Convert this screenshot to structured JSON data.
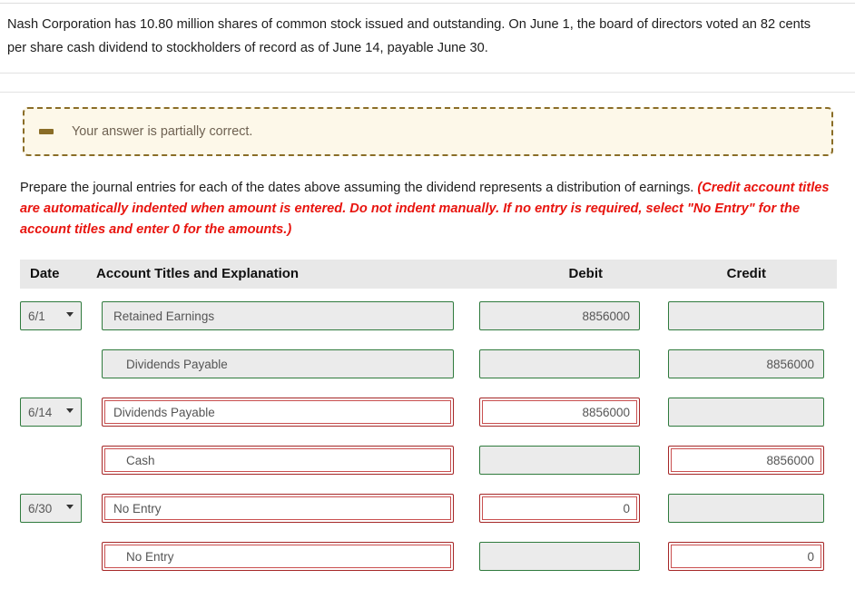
{
  "problem": {
    "statement": "Nash Corporation has 10.80 million shares of common stock issued and outstanding. On June 1, the board of directors voted an 82 cents per share cash dividend to stockholders of record as of June 14, payable June 30."
  },
  "alert": {
    "icon": "minus-icon",
    "message": "Your answer is partially correct.",
    "border_color": "#8a6d27",
    "background_color": "#fdf8e9"
  },
  "instructions": {
    "lead": "Prepare the journal entries for each of the dates above assuming the dividend represents a distribution of earnings. ",
    "emphasis": "(Credit account titles are automatically indented when amount is entered. Do not indent manually. If no entry is required, select \"No Entry\" for the account titles and enter 0 for the amounts.)",
    "emphasis_color": "#e8150f"
  },
  "journal_table": {
    "headers": {
      "date": "Date",
      "account": "Account Titles and Explanation",
      "debit": "Debit",
      "credit": "Credit"
    },
    "header_background": "#e8e8e8",
    "status_colors": {
      "correct": "#2f7a3d",
      "incorrect": "#a52727"
    },
    "rows": [
      {
        "date": "6/1",
        "date_status": "correct",
        "account": "Retained Earnings",
        "account_status": "correct",
        "account_indented": false,
        "debit": "8856000",
        "debit_status": "correct",
        "credit": "",
        "credit_status": "correct"
      },
      {
        "date": "",
        "date_status": "none",
        "account": "Dividends Payable",
        "account_status": "correct",
        "account_indented": true,
        "debit": "",
        "debit_status": "correct",
        "credit": "8856000",
        "credit_status": "correct"
      },
      {
        "date": "6/14",
        "date_status": "correct",
        "account": "Dividends Payable",
        "account_status": "incorrect",
        "account_indented": false,
        "debit": "8856000",
        "debit_status": "incorrect",
        "credit": "",
        "credit_status": "correct"
      },
      {
        "date": "",
        "date_status": "none",
        "account": "Cash",
        "account_status": "incorrect",
        "account_indented": true,
        "debit": "",
        "debit_status": "correct",
        "credit": "8856000",
        "credit_status": "incorrect"
      },
      {
        "date": "6/30",
        "date_status": "correct",
        "account": "No Entry",
        "account_status": "incorrect",
        "account_indented": false,
        "debit": "0",
        "debit_status": "incorrect",
        "credit": "",
        "credit_status": "correct"
      },
      {
        "date": "",
        "date_status": "none",
        "account": "No Entry",
        "account_status": "incorrect",
        "account_indented": true,
        "debit": "",
        "debit_status": "correct",
        "credit": "0",
        "credit_status": "incorrect"
      }
    ]
  }
}
